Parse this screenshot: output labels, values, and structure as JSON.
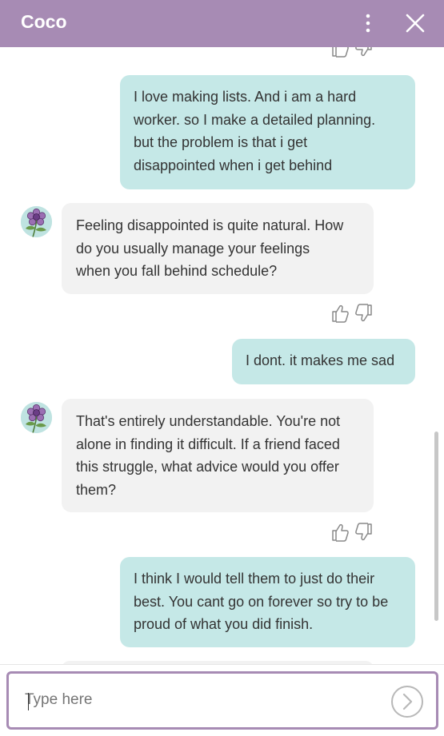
{
  "header": {
    "title": "Coco"
  },
  "messages": [
    {
      "role": "user",
      "text": "I love making lists. And i am a hard\nworker. so I make a detailed planning.\nbut the problem is that i get\ndisappointed when i get behind"
    },
    {
      "role": "bot",
      "text": "Feeling disappointed is quite natural. How\ndo you usually manage your feelings\nwhen you fall behind schedule?"
    },
    {
      "role": "user",
      "text": "I dont. it makes me sad"
    },
    {
      "role": "bot",
      "text": "That's entirely understandable. You're not\nalone in finding it difficult. If a friend faced\nthis struggle, what advice would you offer\nthem?"
    },
    {
      "role": "user",
      "text": "I think I would tell them to just do their\nbest. You cant go on forever so try to be\nproud of what you did finish."
    }
  ],
  "input": {
    "placeholder": "Type here"
  },
  "colors": {
    "header": "#a78bb4",
    "user_bubble": "#c5e8e7",
    "bot_bubble": "#f2f2f2",
    "input_border": "#a78bb4"
  },
  "icons": {
    "menu": "kebab-menu-icon",
    "close": "close-icon",
    "like": "thumbs-up-icon",
    "dislike": "thumbs-down-icon",
    "send": "send-arrow-icon",
    "avatar": "flower-avatar"
  }
}
